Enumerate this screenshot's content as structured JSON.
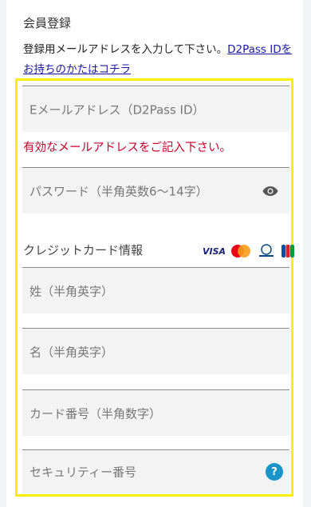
{
  "section": {
    "title": "会員登録",
    "intro_text": "登録用メールアドレスを入力して下さい。",
    "intro_link": "D2Pass IDをお持ちのかたはコチラ"
  },
  "form": {
    "email_placeholder": "Eメールアドレス（D2Pass ID）",
    "email_error": "有効なメールアドレスをご記入下さい。",
    "password_placeholder": "パスワード（半角英数6～14字）",
    "card_heading": "クレジットカード情報",
    "card_brands": [
      "VISA",
      "Mastercard",
      "Diners Club",
      "JCB"
    ],
    "last_name_placeholder": "姓（半角英字）",
    "first_name_placeholder": "名（半角英字）",
    "card_number_placeholder": "カード番号（半角数字）",
    "security_code_placeholder": "セキュリティー番号",
    "help_symbol": "?"
  },
  "colors": {
    "error": "#c8002b",
    "link": "#1a1aa6",
    "highlight": "#f8f000",
    "help": "#1a95c9"
  },
  "icons": [
    "eye-icon",
    "visa-logo",
    "mastercard-logo",
    "diners-club-logo",
    "jcb-logo",
    "help-icon"
  ]
}
